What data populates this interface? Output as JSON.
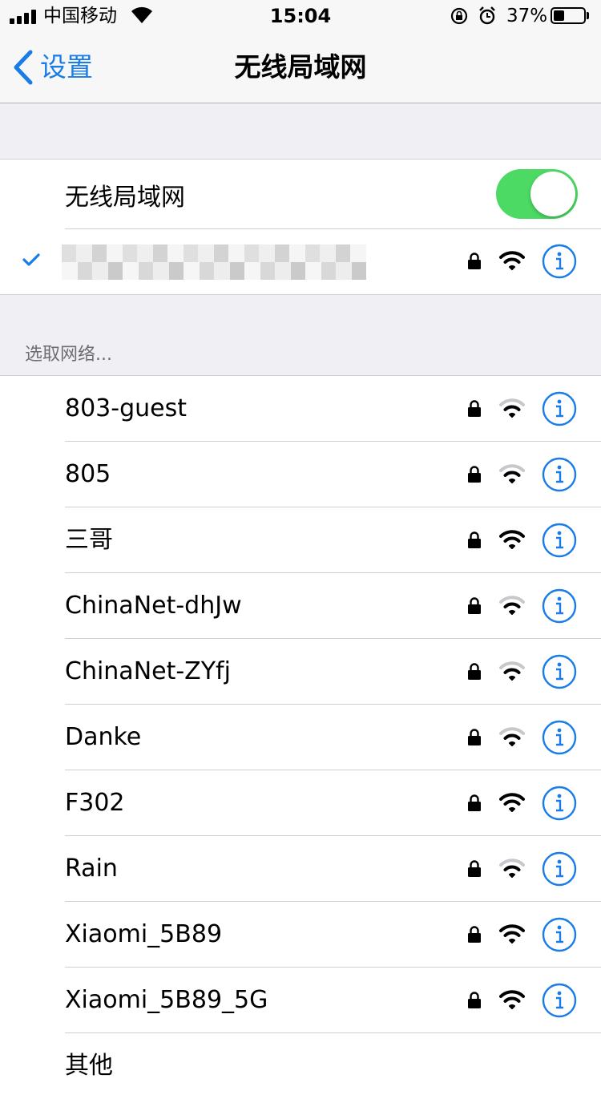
{
  "status_bar": {
    "carrier": "中国移动",
    "time": "15:04",
    "battery_percent": "37%",
    "battery_level": 0.37
  },
  "nav": {
    "back_label": "设置",
    "title": "无线局域网"
  },
  "wifi_toggle": {
    "label": "无线局域网",
    "on": true,
    "on_color": "#4cd964"
  },
  "section_header": "选取网络...",
  "networks": [
    {
      "name": "803-guest",
      "signal": "medium"
    },
    {
      "name": "805",
      "signal": "medium"
    },
    {
      "name": "三哥",
      "signal": "full"
    },
    {
      "name": "ChinaNet-dhJw",
      "signal": "medium"
    },
    {
      "name": "ChinaNet-ZYfj",
      "signal": "medium"
    },
    {
      "name": "Danke",
      "signal": "medium"
    },
    {
      "name": "F302",
      "signal": "full"
    },
    {
      "name": "Rain",
      "signal": "medium"
    },
    {
      "name": "Xiaomi_5B89",
      "signal": "full"
    },
    {
      "name": "Xiaomi_5B89_5G",
      "signal": "full"
    }
  ],
  "other_label": "其他",
  "colors": {
    "accent": "#1a7ce8",
    "background": "#efeff4"
  }
}
